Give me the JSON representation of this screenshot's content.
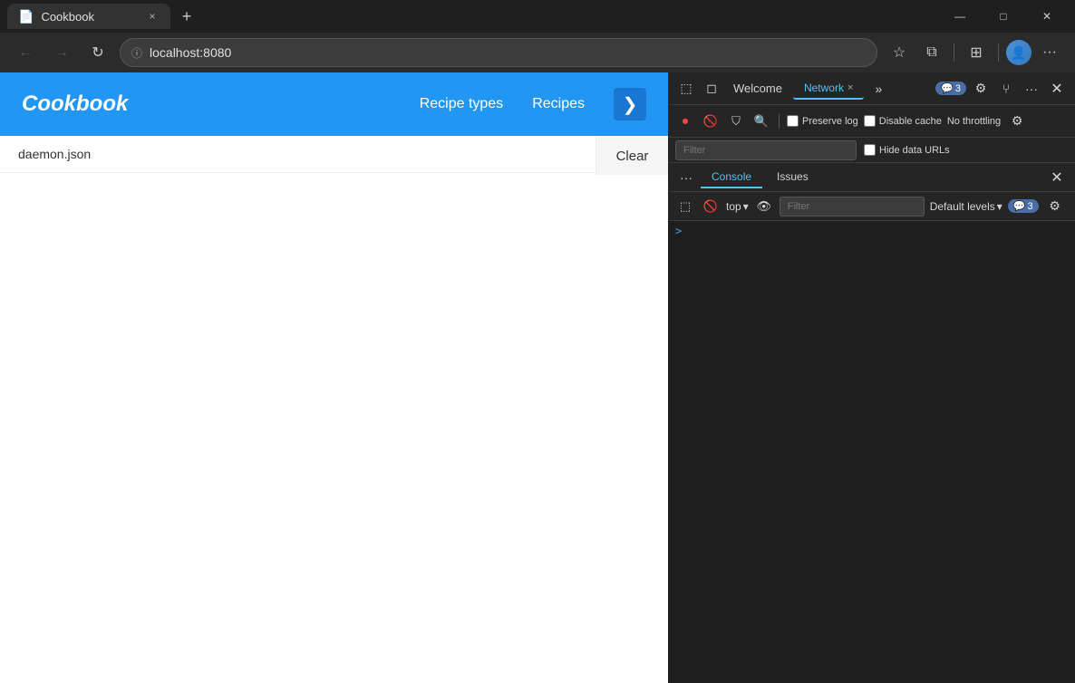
{
  "browser": {
    "tab": {
      "favicon": "📄",
      "title": "Cookbook",
      "close_label": "×"
    },
    "new_tab_label": "+",
    "window_controls": {
      "minimize": "—",
      "maximize": "□",
      "close": "✕"
    },
    "nav": {
      "back_label": "←",
      "forward_label": "→",
      "refresh_label": "↻",
      "address": "localhost:8080",
      "lock_icon": "ⓘ",
      "star_icon": "☆",
      "extensions_icon": "⧉",
      "collections_icon": "⊞",
      "profile_icon": "👤",
      "more_icon": "···"
    }
  },
  "webpage": {
    "logo": "Cookbook",
    "nav_links": [
      "Recipe types",
      "Recipes"
    ],
    "nav_btn_icon": "❯",
    "file_items": [
      "daemon.json"
    ],
    "clear_label": "Clear"
  },
  "devtools": {
    "toolbar": {
      "drawer_icon": "⬚",
      "responsive_icon": "◻",
      "welcome_tab": "Welcome",
      "network_tab": "Network",
      "more_tabs_icon": "»",
      "badge_count": "3",
      "settings_icon": "⚙",
      "branch_icon": "⑂",
      "more_icon": "···",
      "close_icon": "✕"
    },
    "network": {
      "record_btn": "⏺",
      "clear_icon": "🚫",
      "filter_icon": "⛉",
      "search_icon": "🔍",
      "preserve_log_label": "Preserve log",
      "disable_cache_label": "Disable cache",
      "throttle_label": "No throttling",
      "settings_icon": "⚙",
      "filter_placeholder": "Filter",
      "hide_data_urls_label": "Hide data URLs"
    },
    "console_panel": {
      "drawer_icon": "⬚",
      "no_icon": "🚫",
      "context_label": "top",
      "context_arrow": "▾",
      "eye_icon": "👁",
      "filter_placeholder": "Filter",
      "levels_label": "Default levels",
      "levels_arrow": "▾",
      "badge_count": "3",
      "settings_icon": "⚙"
    },
    "console_tabs": {
      "console_label": "Console",
      "issues_label": "Issues",
      "close_icon": "✕"
    },
    "console_content": {
      "prompt": ">"
    }
  }
}
